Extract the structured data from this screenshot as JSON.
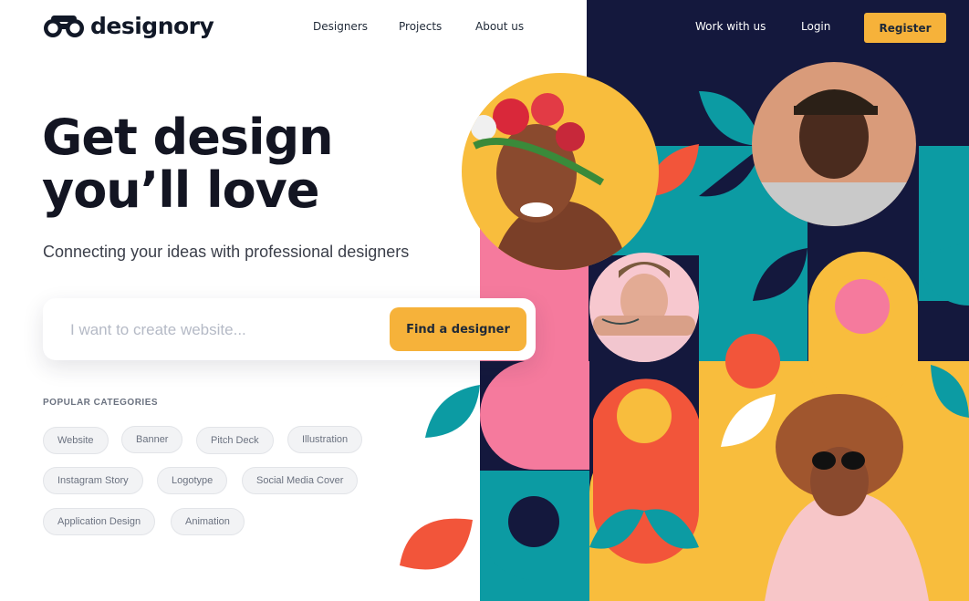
{
  "brand": {
    "name": "designory",
    "colors": {
      "accent": "#f6b23a",
      "dark": "#14183d",
      "teal": "#0c9ba3",
      "coral": "#f2553a",
      "pink": "#f57a9d",
      "yellow": "#f8bd3d"
    }
  },
  "nav": {
    "links": [
      "Designers",
      "Projects",
      "About us"
    ],
    "work_with_us": "Work with us",
    "login": "Login",
    "register": "Register"
  },
  "hero": {
    "title_line1": "Get design",
    "title_line2": "you’ll love",
    "subtitle": "Connecting your ideas with professional designers"
  },
  "search": {
    "placeholder": "I want to create website...",
    "button": "Find a designer"
  },
  "categories": {
    "title": "POPULAR CATEGORIES",
    "items": [
      "Website",
      "Banner",
      "Pitch Deck",
      "Illustration",
      "Instagram Story",
      "Logotype",
      "Social Media Cover",
      "Application Design",
      "Animation"
    ]
  },
  "icons": {
    "logo": "binoculars-icon"
  }
}
